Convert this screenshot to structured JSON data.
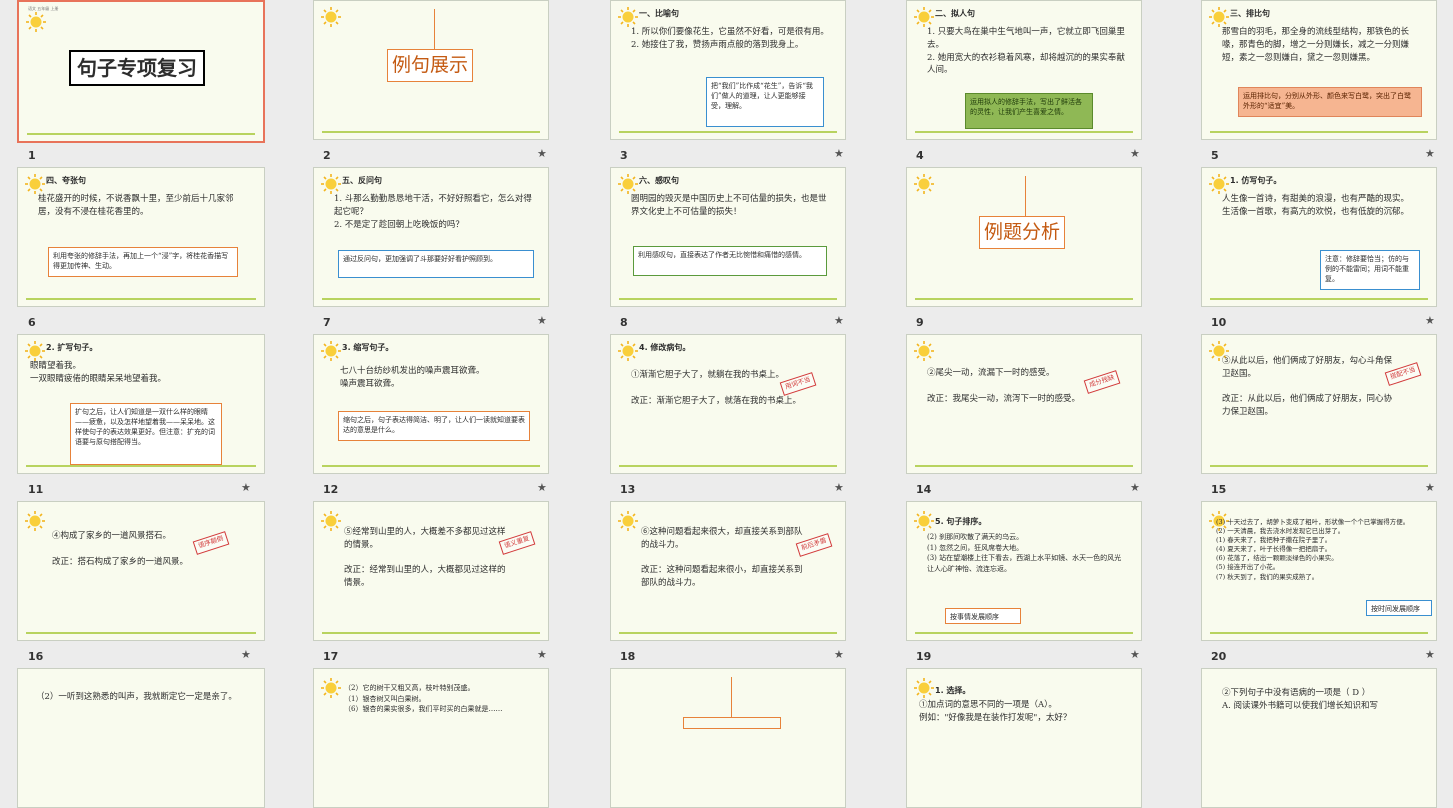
{
  "header_tiny": "语文 五年级 上册",
  "star": "★",
  "slides": {
    "s1": {
      "num": "1",
      "title": "句子专项复习"
    },
    "s2": {
      "num": "2",
      "title": "例句展示"
    },
    "s3": {
      "num": "3",
      "heading": "一、比喻句",
      "body": "1. 所以你们要像花生，它虽然不好看，可是很有用。\n2. 她接住了我，赞扬声雨点般的落到我身上。",
      "note": "把“我们”比作成“花生”，告诉“我们”做人的道理，让人更能够接受，理解。"
    },
    "s4": {
      "num": "4",
      "heading": "二、拟人句",
      "body": "1. 只要大鸟在巢中生气地叫一声，它就立即飞回巢里去。\n2. 她用宽大的衣衫稳着风寒，却将越沉的的果实奉献人间。",
      "note": "运用拟人的修辞手法，写出了鲜活各的灵性，让我们产生喜爱之情。"
    },
    "s5": {
      "num": "5",
      "heading": "三、排比句",
      "body": "那雪白的羽毛，那全身的流线型结构，那铁色的长喙，那青色的脚，增之一分则嫌长，减之一分则嫌短，素之一忽则嫌白，黛之一忽则嫌黑。",
      "note": "运用排比句，分别从外形、颜色来写白鹭，突出了白鹭外形的“适宜”美。"
    },
    "s6": {
      "num": "6",
      "heading": "四、夸张句",
      "body": "桂花盛开的时候，不说香飘十里，至少前后十几家邻居，没有不浸在桂花香里的。",
      "note": "利用夸张的修辞手法，再加上一个“浸”字，将桂花香描写得更加传神、生动。"
    },
    "s7": {
      "num": "7",
      "heading": "五、反问句",
      "body": "1. 斗那么勤勤恳恳地干活，不好好照看它，怎么对得起它呢？\n2. 不是定了趁回朝上吃晚饭的吗？",
      "note": "通过反问句，更加强调了斗那要好好看护照顾到。"
    },
    "s8": {
      "num": "8",
      "heading": "六、感叹句",
      "body": "圆明园的毁灭是中国历史上不可估量的损失，也是世界文化史上不可估量的损失！",
      "note": "利用感叹句，直接表达了作者无比惋惜和痛惜的感情。"
    },
    "s9": {
      "num": "9",
      "title": "例题分析"
    },
    "s10": {
      "num": "10",
      "heading": "1. 仿写句子。",
      "body": "人生像一首诗，有甜美的浪漫，也有严酷的现实。\n生活像一首歌，有高亢的欢悦，也有低旋的沉郁。",
      "note": "注意：修辞要恰当；仿的与例的不能雷同；用词不能重复。"
    },
    "s11": {
      "num": "11",
      "heading": "2. 扩写句子。",
      "body": "眼睛望着我。\n一双眼睛疲倦的眼睛呆呆地望着我。",
      "note": "扩句之后，让人们知道是一双什么样的眼睛——疲惫，以及怎样地望着我——呆呆地。这样使句子的表达效果更好。但注意：扩充的词语要与原句搭配得当。"
    },
    "s12": {
      "num": "12",
      "heading": "3. 缩写句子。",
      "body": "七八十台纺纱机发出的噪声震耳欲聋。\n噪声震耳欲聋。",
      "note": "缩句之后，句子表达得简洁、明了，让人们一读就知道要表达的意思是什么。"
    },
    "s13": {
      "num": "13",
      "heading": "4. 修改病句。",
      "body": "①渐渐它胆子大了，就躺在我的书桌上。\n\n改正：渐渐它胆子大了，就落在我的书桌上。",
      "stamp": "用词不当"
    },
    "s14": {
      "num": "14",
      "body": "②尾尖一动，流漏下一时的感受。\n\n改正：我尾尖一动，流泻下一时的感受。",
      "stamp": "成分残缺"
    },
    "s15": {
      "num": "15",
      "body": "③从此以后，他们俩成了好朋友，勾心斗角保卫赵国。\n\n改正：从此以后，他们俩成了好朋友，同心协力保卫赵国。",
      "stamp": "搭配不当"
    },
    "s16": {
      "num": "16",
      "body": "④构成了家乡的一道风景搭石。\n\n改正：搭石构成了家乡的一道风景。",
      "stamp": "语序颠倒"
    },
    "s17": {
      "num": "17",
      "body": "⑤经常到山里的人，大概差不多都见过这样的情景。\n\n改正：经常到山里的人，大概都见过这样的情景。",
      "stamp": "语义重复"
    },
    "s18": {
      "num": "18",
      "body": "⑥这种问题看起来很大，却直接关系到部队的战斗力。\n\n改正：这种问题看起来很小，却直接关系到部队的战斗力。",
      "stamp": "前后矛盾"
    },
    "s19": {
      "num": "19",
      "heading": "5. 句子排序。",
      "body": "(2) 刹那间吹散了满天的乌云。\n(1) 忽然之间，狂风席卷大地。\n(3) 站在望潮楼上往下看去，西湖上水平如镜、水天一色的风光让人心旷神怡、流连忘返。",
      "note": "按事情发展顺序"
    },
    "s20": {
      "num": "20",
      "body": "(3) 十天过去了，胡萝卜变成了粗叶，形状像一个个已掌握得方便。\n(2) 一天清晨，我去浇水时发现它已出芽了。\n(1) 春天来了，我把种子撒在院子里了。\n(4) 夏天来了，叶子长得像一把把扇子。\n(6) 花落了，结出一颗颗淡绿色的小果实。\n(5) 接连开出了小花。\n(7) 秋天到了，我们的果实成熟了。",
      "note": "按时间发展顺序"
    },
    "s21": {
      "body": "（2）一听到这熟悉的叫声，我就断定它一定是亲了。"
    },
    "s22": {
      "body": "（2）它的树干又粗又高，枝叶特别茂盛。\n（1）银杏树又叫白果树。\n（6）银杏的果实很多，我们平时买的白果就是……"
    },
    "s23": {},
    "s24": {
      "heading": "1. 选择。",
      "body": "①加点词的意思不同的一项是（A）。\n例如：\"好像我是在装作打发呢\"，太好？"
    },
    "s25": {
      "body": "②下列句子中没有语病的一项是（ D ）\nA. 阅读课外书籍可以使我们增长知识和写"
    }
  }
}
